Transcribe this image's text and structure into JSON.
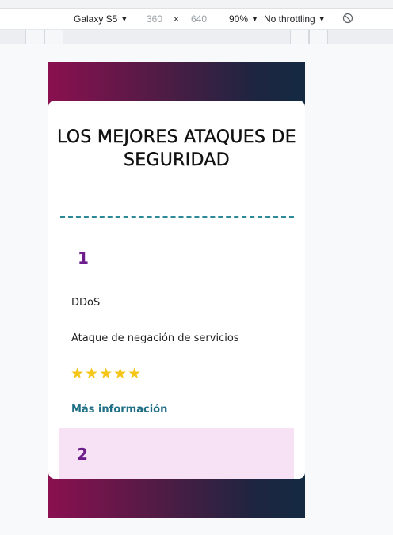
{
  "devtools": {
    "device": "Galaxy S5",
    "width": "360",
    "times": "×",
    "height": "640",
    "zoom": "90%",
    "throttling": "No throttling",
    "caret": "▼"
  },
  "page": {
    "title": "LOS MEJORES ATAQUES DE SEGURIDAD",
    "items": [
      {
        "number": "1",
        "name": "DDoS",
        "description": "Ataque de negación de servicios",
        "rating": 5,
        "stars": "★★★★★",
        "link": "Más información"
      },
      {
        "number": "2"
      }
    ]
  },
  "colors": {
    "gradient_start": "#8a1050",
    "gradient_end": "#142a42",
    "divider": "#2c8a96",
    "number": "#6e1e8c",
    "star": "#f5c518",
    "link": "#1f6f85",
    "item2_bg": "#f6e2f4"
  }
}
